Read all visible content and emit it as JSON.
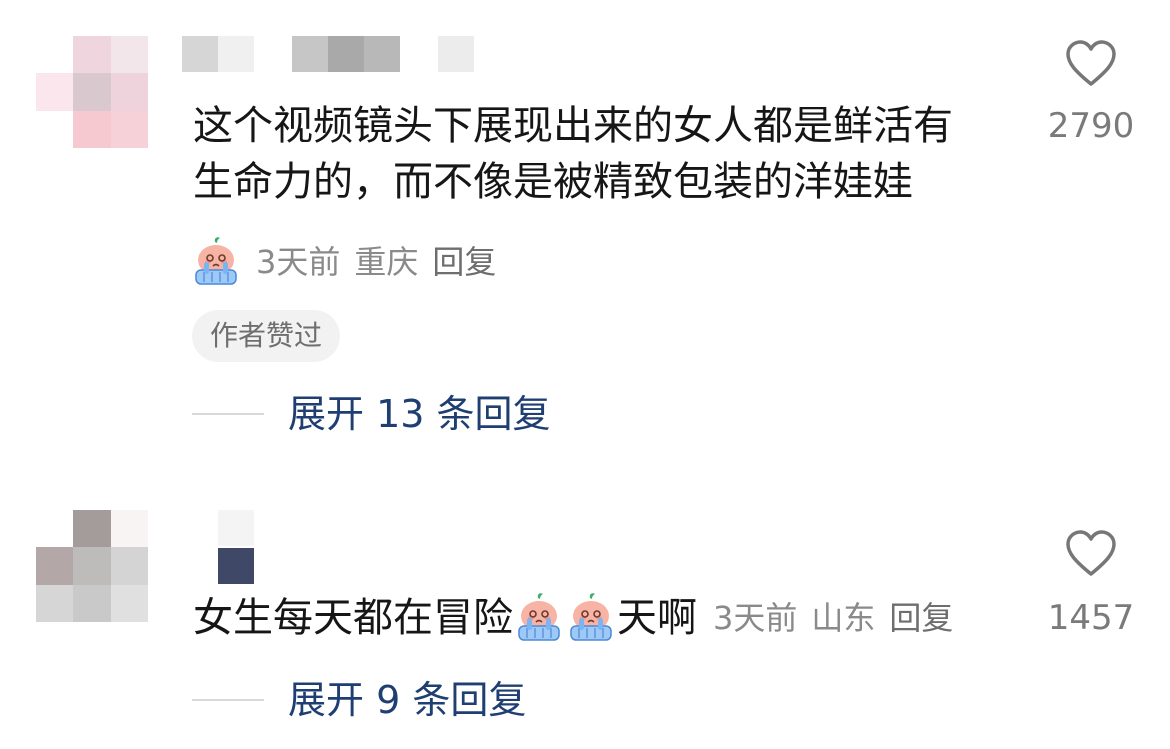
{
  "comments": [
    {
      "text_lines": [
        "这个视频镜头下展现出来的女人都是鲜活有",
        "生命力的，而不像是被精致包装的洋娃娃"
      ],
      "meta_emoji": "crying-peach-emoji",
      "time": "3天前",
      "location": "重庆",
      "reply_label": "回复",
      "author_badge": "作者赞过",
      "likes": "2790",
      "expand_label": "展开 13 条回复"
    },
    {
      "text_prefix": "女生每天都在冒险",
      "inline_emojis": [
        "crying-peach-emoji",
        "crying-peach-emoji"
      ],
      "text_suffix": "天啊",
      "time": "3天前",
      "location": "山东",
      "reply_label": "回复",
      "likes": "1457",
      "expand_label": "展开 9 条回复"
    }
  ],
  "colors": {
    "expand_link": "#1f3f73",
    "meta_gray": "#8a8a8a",
    "badge_bg": "#f2f2f2"
  }
}
